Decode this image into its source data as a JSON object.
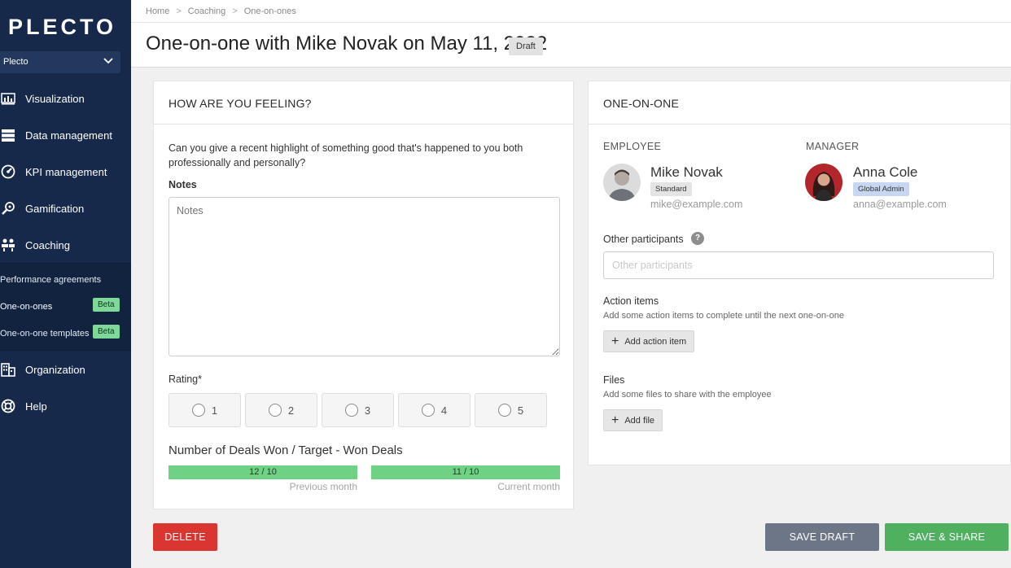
{
  "sidebar": {
    "logo": "PLECTO",
    "org": "Plecto",
    "nav": [
      {
        "label": "Visualization",
        "icon": "chart-icon"
      },
      {
        "label": "Data management",
        "icon": "database-icon"
      },
      {
        "label": "KPI management",
        "icon": "gauge-icon"
      },
      {
        "label": "Gamification",
        "icon": "gamepad-icon"
      },
      {
        "label": "Coaching",
        "icon": "people-icon"
      },
      {
        "label": "Organization",
        "icon": "building-icon"
      },
      {
        "label": "Help",
        "icon": "lifebuoy-icon"
      }
    ],
    "coaching_sub": [
      {
        "label": "Performance agreements",
        "badge": ""
      },
      {
        "label": "One-on-ones",
        "badge": "Beta"
      },
      {
        "label": "One-on-one templates",
        "badge": "Beta"
      }
    ]
  },
  "breadcrumb": [
    "Home",
    "Coaching",
    "One-on-ones"
  ],
  "breadcrumb_sep": ">",
  "page": {
    "title": "One-on-one with Mike Novak on May 11, 2022",
    "status": "Draft"
  },
  "feeling": {
    "heading": "HOW ARE YOU FEELING?",
    "question": "Can you give a recent highlight of something good that's happened to you both professionally and personally?",
    "notes_label": "Notes",
    "notes_placeholder": "Notes",
    "rating_label": "Rating*",
    "ratings": [
      "1",
      "2",
      "3",
      "4",
      "5"
    ],
    "deals_title": "Number of Deals Won / Target - Won Deals",
    "bars": [
      {
        "text": "12 / 10",
        "caption": "Previous month",
        "value": 12,
        "target": 10
      },
      {
        "text": "11 / 10",
        "caption": "Current month",
        "value": 11,
        "target": 10
      }
    ]
  },
  "one_on_one": {
    "heading": "ONE-ON-ONE",
    "employee": {
      "label": "EMPLOYEE",
      "name": "Mike Novak",
      "role": "Standard",
      "email": "mike@example.com"
    },
    "manager": {
      "label": "MANAGER",
      "name": "Anna Cole",
      "role": "Global Admin",
      "email": "anna@example.com"
    },
    "participants_label": "Other participants",
    "participants_help": "?",
    "participants_placeholder": "Other participants",
    "action_items_label": "Action items",
    "action_items_desc": "Add some action items to complete until the next one-on-one",
    "add_action_label": "Add action item",
    "files_label": "Files",
    "files_desc": "Add some files to share with the employee",
    "add_file_label": "Add file"
  },
  "footer": {
    "delete": "DELETE",
    "save_draft": "SAVE DRAFT",
    "save_share": "SAVE & SHARE"
  },
  "colors": {
    "sidebar": "#16294a",
    "beta": "#7ed89a",
    "progress": "#6fd184",
    "delete": "#d93631",
    "save_draft": "#6d7686",
    "save_share": "#4fb060",
    "role_standard": "#e4e4e4",
    "role_admin": "#c7d7f2"
  }
}
